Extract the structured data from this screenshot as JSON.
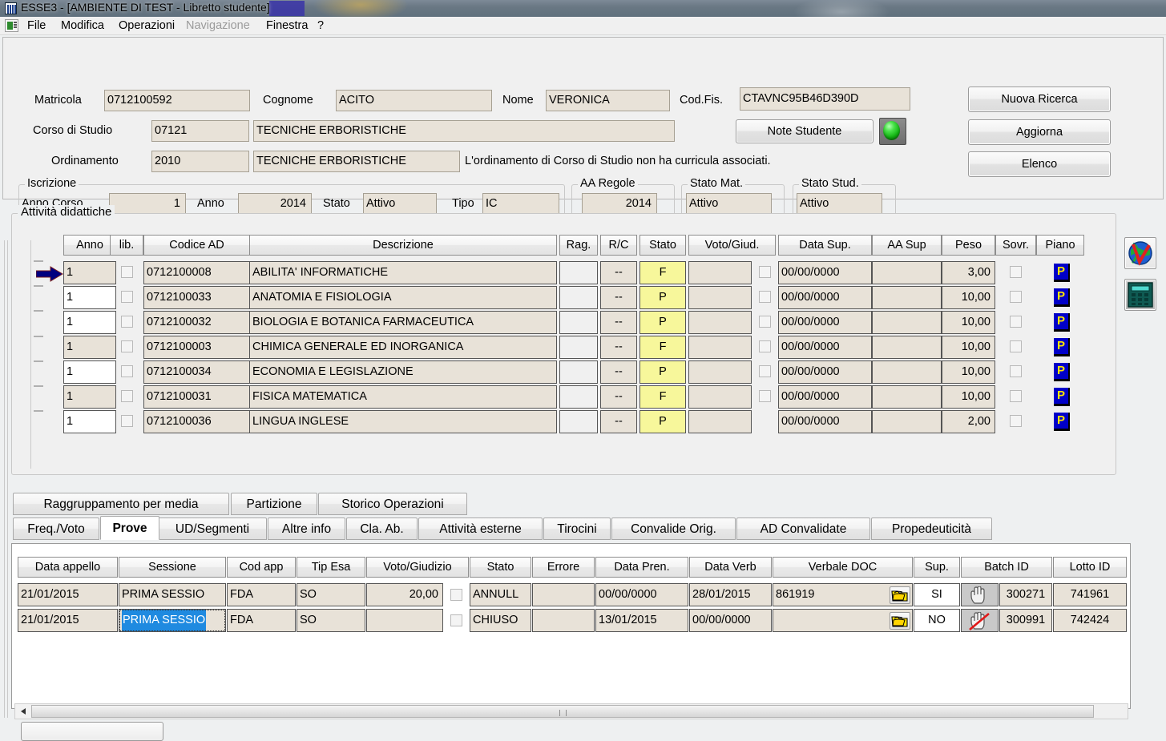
{
  "window": {
    "title": "ESSE3 - [AMBIENTE DI TEST - Libretto studente]",
    "icon": "app-icon"
  },
  "menubar": {
    "items": [
      {
        "label": "File",
        "disabled": false
      },
      {
        "label": "Modifica",
        "disabled": false
      },
      {
        "label": "Operazioni",
        "disabled": false
      },
      {
        "label": "Navigazione",
        "disabled": true
      },
      {
        "label": "Finestra",
        "disabled": false
      },
      {
        "label": "?",
        "disabled": false
      }
    ]
  },
  "student": {
    "matricola_label": "Matricola",
    "matricola_value": "0712100592",
    "cognome_label": "Cognome",
    "cognome_value": "ACITO",
    "nome_label": "Nome",
    "nome_value": "VERONICA",
    "codfis_label": "Cod.Fis.",
    "codfis_value": "CTAVNC95B46D390D",
    "corso_label": "Corso di Studio",
    "corso_code": "07121",
    "corso_desc": "TECNICHE ERBORISTICHE",
    "ordinamento_label": "Ordinamento",
    "ordinamento_code": "2010",
    "ordinamento_desc": "TECNICHE ERBORISTICHE",
    "curricula_note": "L'ordinamento di Corso di Studio non ha curricula associati."
  },
  "buttons": {
    "note_studente": "Note Studente",
    "nuova_ricerca": "Nuova Ricerca",
    "aggiorna": "Aggiorna",
    "elenco": "Elenco",
    "led": "green-led-button"
  },
  "iscrizione": {
    "group_title": "Iscrizione",
    "anno_corso_label": "Anno Corso",
    "anno_corso_value": "1",
    "anno_label": "Anno",
    "anno_value": "2014",
    "stato_label": "Stato",
    "stato_value": "Attivo",
    "tipo_label": "Tipo",
    "tipo_value": "IC"
  },
  "aa_regole": {
    "group_title": "AA Regole",
    "value": "2014"
  },
  "stato_mat": {
    "group_title": "Stato Mat.",
    "value": "Attivo"
  },
  "stato_stud": {
    "group_title": "Stato Stud.",
    "value": "Attivo"
  },
  "attivita": {
    "section_title": "Attività didattiche",
    "columns": [
      "Anno",
      "lib.",
      "Codice AD",
      "Descrizione",
      "Rag.",
      "R/C",
      "Stato",
      "Voto/Giud.",
      "Data Sup.",
      "AA Sup",
      "Peso",
      "Sovr.",
      "Piano"
    ],
    "rows": [
      {
        "anno": "1",
        "lib": false,
        "codice": "0712100008",
        "descrizione": "ABILITA' INFORMATICHE",
        "rag": "",
        "rc": "--",
        "stato": "F",
        "voto": "",
        "voto_check": false,
        "data_sup": "00/00/0000",
        "aa_sup": "",
        "peso": "3,00",
        "sovr": false,
        "piano": "P",
        "selected": true,
        "anno_readonly": true
      },
      {
        "anno": "1",
        "lib": false,
        "codice": "0712100033",
        "descrizione": "ANATOMIA E FISIOLOGIA",
        "rag": "",
        "rc": "--",
        "stato": "P",
        "voto": "",
        "voto_check": false,
        "data_sup": "00/00/0000",
        "aa_sup": "",
        "peso": "10,00",
        "sovr": false,
        "piano": "P",
        "selected": false,
        "anno_readonly": false
      },
      {
        "anno": "1",
        "lib": false,
        "codice": "0712100032",
        "descrizione": "BIOLOGIA E BOTANICA FARMACEUTICA",
        "rag": "",
        "rc": "--",
        "stato": "P",
        "voto": "",
        "voto_check": false,
        "data_sup": "00/00/0000",
        "aa_sup": "",
        "peso": "10,00",
        "sovr": false,
        "piano": "P",
        "selected": false,
        "anno_readonly": false
      },
      {
        "anno": "1",
        "lib": false,
        "codice": "0712100003",
        "descrizione": "CHIMICA GENERALE ED INORGANICA",
        "rag": "",
        "rc": "--",
        "stato": "F",
        "voto": "",
        "voto_check": false,
        "data_sup": "00/00/0000",
        "aa_sup": "",
        "peso": "10,00",
        "sovr": false,
        "piano": "P",
        "selected": false,
        "anno_readonly": true
      },
      {
        "anno": "1",
        "lib": false,
        "codice": "0712100034",
        "descrizione": "ECONOMIA E LEGISLAZIONE",
        "rag": "",
        "rc": "--",
        "stato": "P",
        "voto": "",
        "voto_check": false,
        "data_sup": "00/00/0000",
        "aa_sup": "",
        "peso": "10,00",
        "sovr": false,
        "piano": "P",
        "selected": false,
        "anno_readonly": false
      },
      {
        "anno": "1",
        "lib": false,
        "codice": "0712100031",
        "descrizione": "FISICA MATEMATICA",
        "rag": "",
        "rc": "--",
        "stato": "F",
        "voto": "",
        "voto_check": false,
        "data_sup": "00/00/0000",
        "aa_sup": "",
        "peso": "10,00",
        "sovr": false,
        "piano": "P",
        "selected": false,
        "anno_readonly": true
      },
      {
        "anno": "1",
        "lib": false,
        "codice": "0712100036",
        "descrizione": "LINGUA INGLESE",
        "rag": "",
        "rc": "--",
        "stato": "P",
        "voto": "",
        "voto_check": false,
        "data_sup": "00/00/0000",
        "aa_sup": "",
        "peso": "2,00",
        "sovr": false,
        "piano": "P",
        "selected": false,
        "anno_readonly": false
      }
    ],
    "side_icons": [
      {
        "name": "globe-icon",
        "title": ""
      },
      {
        "name": "calculator-icon",
        "title": ""
      }
    ]
  },
  "tabs_top": [
    {
      "label": "Raggruppamento per media",
      "active": false
    },
    {
      "label": "Partizione",
      "active": false
    },
    {
      "label": "Storico Operazioni",
      "active": false
    }
  ],
  "tabs_bottom": [
    {
      "label": "Freq./Voto",
      "active": false
    },
    {
      "label": "Prove",
      "active": true
    },
    {
      "label": "UD/Segmenti",
      "active": false
    },
    {
      "label": "Altre info",
      "active": false
    },
    {
      "label": "Cla. Ab.",
      "active": false
    },
    {
      "label": "Attività esterne",
      "active": false
    },
    {
      "label": "Tirocini",
      "active": false
    },
    {
      "label": "Convalide Orig.",
      "active": false
    },
    {
      "label": "AD Convalidate",
      "active": false
    },
    {
      "label": "Propedeuticità",
      "active": false
    }
  ],
  "prove": {
    "columns": [
      "Data appello",
      "Sessione",
      "Cod app",
      "Tip Esa",
      "Voto/Giudizio",
      "Stato",
      "Errore",
      "Data Pren.",
      "Data Verb",
      "Verbale DOC",
      "Sup.",
      "Batch ID",
      "Lotto ID"
    ],
    "rows": [
      {
        "data_appello": "21/01/2015",
        "sessione": "PRIMA SESSIO",
        "sessione_selected": false,
        "cod_app": "FDA",
        "tip_esa": "SO",
        "voto": "20,00",
        "voto_check": false,
        "stato": "ANNULL",
        "errore": "",
        "data_pren": "00/00/0000",
        "data_verb": "28/01/2015",
        "verbale_doc": "861919",
        "sup": "SI",
        "batch_id": "300271",
        "lotto_id": "741961",
        "hand_icon": "hand-icon",
        "hand_disabled": false
      },
      {
        "data_appello": "21/01/2015",
        "sessione": "PRIMA SESSIO",
        "sessione_selected": true,
        "cod_app": "FDA",
        "tip_esa": "SO",
        "voto": "",
        "voto_check": false,
        "stato": "CHIUSO",
        "errore": "",
        "data_pren": "13/01/2015",
        "data_verb": "00/00/0000",
        "verbale_doc": "",
        "sup": "NO",
        "batch_id": "300991",
        "lotto_id": "742424",
        "hand_icon": "hand-icon",
        "hand_disabled": true
      }
    ]
  },
  "scrollbar": {
    "name": "horizontal-scrollbar",
    "left_arrow": "arrow-left-icon"
  },
  "colors": {
    "accent_blue": "#000080",
    "status_yellow": "#f7f79b",
    "field_beige": "#e8e2d8",
    "piano_blue": "#0000c8",
    "piano_text": "#ffe600",
    "selection_blue": "#1f8ae0"
  }
}
